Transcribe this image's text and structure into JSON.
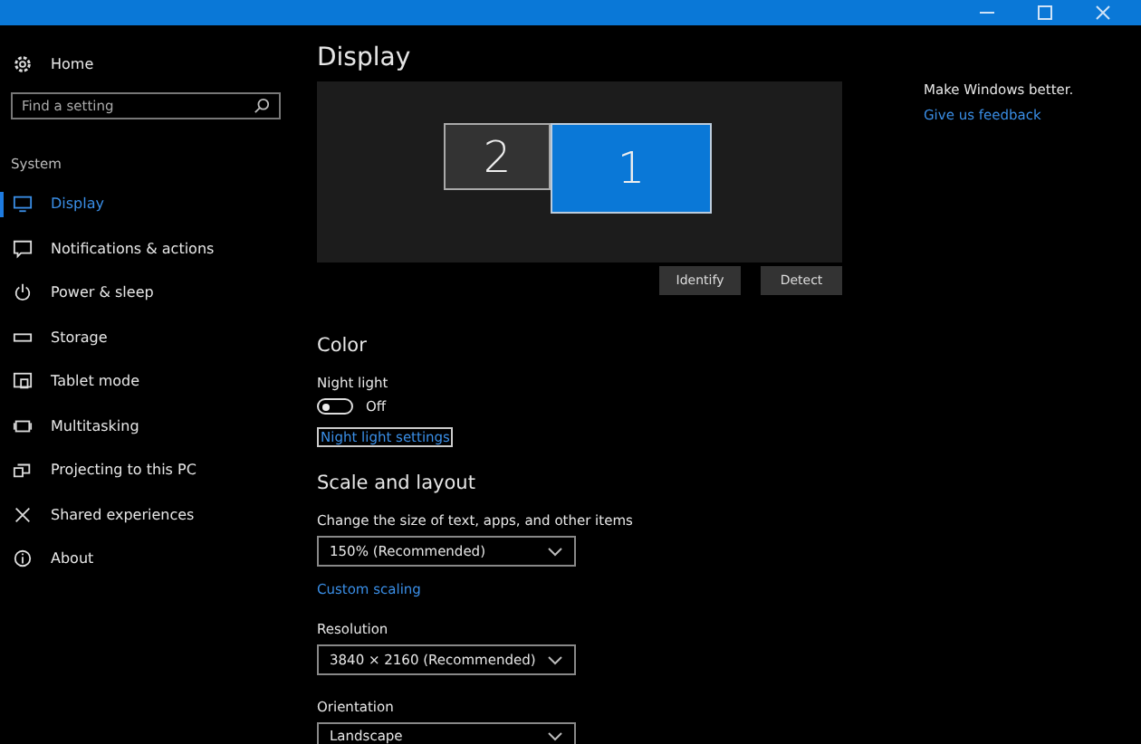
{
  "sidebar": {
    "home": "Home",
    "search": {
      "placeholder": "Find a setting"
    },
    "section": "System",
    "items": [
      {
        "label": "Display",
        "kind": "monitor",
        "selected": true
      },
      {
        "label": "Notifications & actions",
        "kind": "message",
        "selected": false
      },
      {
        "label": "Power & sleep",
        "kind": "power",
        "selected": false
      },
      {
        "label": "Storage",
        "kind": "storage",
        "selected": false
      },
      {
        "label": "Tablet mode",
        "kind": "tablet",
        "selected": false
      },
      {
        "label": "Multitasking",
        "kind": "multitask",
        "selected": false
      },
      {
        "label": "Projecting to this PC",
        "kind": "project",
        "selected": false
      },
      {
        "label": "Shared experiences",
        "kind": "shared",
        "selected": false
      },
      {
        "label": "About",
        "kind": "info",
        "selected": false
      }
    ]
  },
  "main": {
    "title": "Display",
    "monitors": [
      {
        "label": "2",
        "selected": false
      },
      {
        "label": "1",
        "selected": true
      }
    ],
    "buttons": [
      "Identify",
      "Detect"
    ],
    "color_heading": "Color",
    "night_light": {
      "label": "Night light",
      "on": false,
      "state_text": "Off"
    },
    "night_light_link": "Night light settings",
    "scale_heading": "Scale and layout",
    "scale": {
      "label": "Change the size of text, apps, and other items",
      "value": "150% (Recommended)"
    },
    "custom_scaling_link": "Custom scaling",
    "resolution": {
      "label": "Resolution",
      "value": "3840 × 2160 (Recommended)"
    },
    "orientation": {
      "label": "Orientation",
      "value": "Landscape"
    }
  },
  "aside": {
    "text": "Make Windows better.",
    "link": "Give us feedback"
  }
}
